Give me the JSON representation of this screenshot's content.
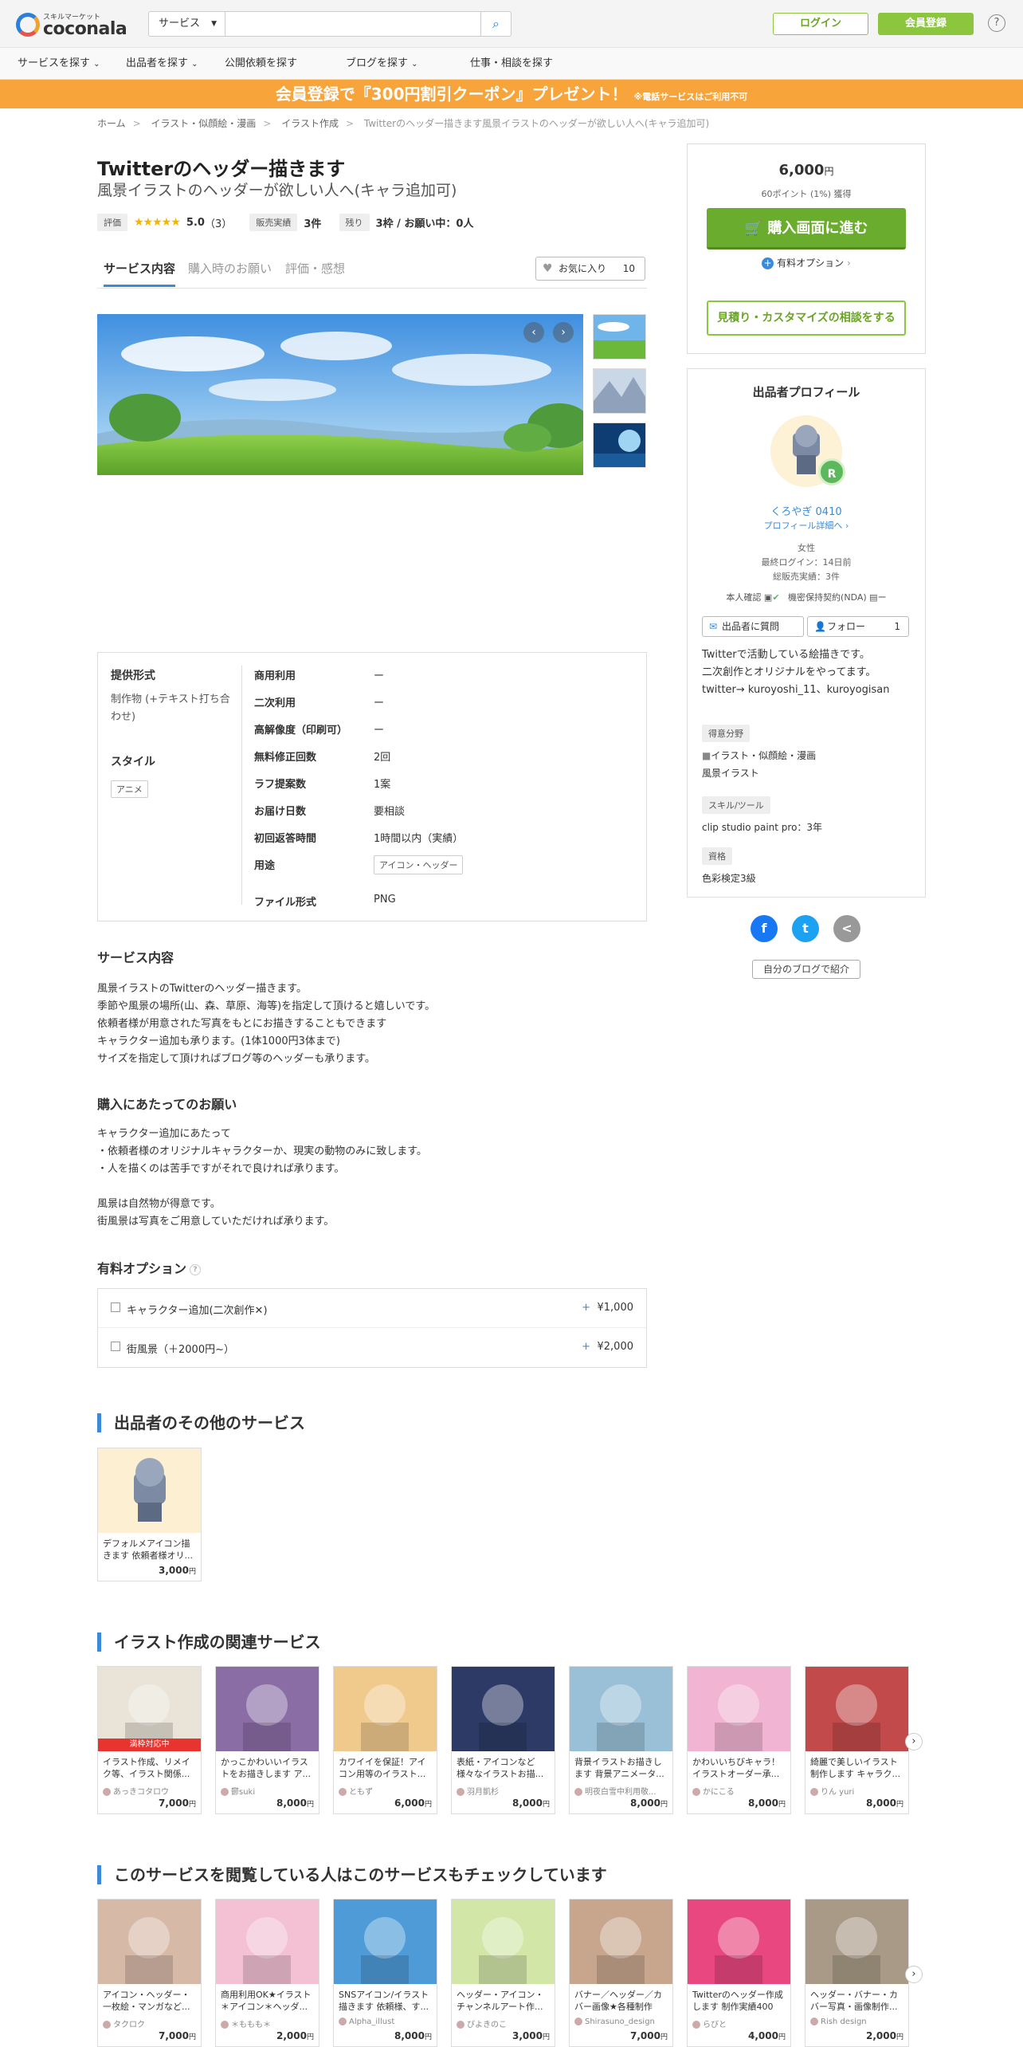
{
  "header": {
    "logo_sub": "スキルマーケット",
    "logo_word": "coconala",
    "search_category": "サービス",
    "search_placeholder": "",
    "login_label": "ログイン",
    "register_label": "会員登録",
    "help_label": "?"
  },
  "nav": [
    "サービスを探す",
    "出品者を探す",
    "公開依頼を探す",
    "ブログを探す",
    "仕事・相談を探す"
  ],
  "banner": {
    "main": "会員登録で『300円割引クーポン』プレゼント！",
    "note": "※電話サービスはご利用不可"
  },
  "breadcrumb": [
    "ホーム",
    "イラスト・似顔絵・漫画",
    "イラスト作成",
    "Twitterのヘッダー描きます風景イラストのヘッダーが欲しい人へ(キャラ追加可)"
  ],
  "service": {
    "title": "Twitterのヘッダー描きます",
    "subtitle": "風景イラストのヘッダーが欲しい人へ(キャラ追加可)",
    "rating_label": "評価",
    "rating": "5.0",
    "rating_count": "（3）",
    "sales_label": "販売実績",
    "sales_value": "3件",
    "remain_label": "残り",
    "remain_value": "3枠 / お願い中：0人"
  },
  "tabs": [
    "サービス内容",
    "購入時のお願い",
    "評価・感想"
  ],
  "favorite": {
    "label": "お気に入り",
    "count": "10"
  },
  "spec": {
    "format_h": "提供形式",
    "format_v": "制作物 (+テキスト打ち合わせ)",
    "style_h": "スタイル",
    "style_tag": "アニメ",
    "rows": [
      {
        "k": "商用利用",
        "v": "ー"
      },
      {
        "k": "二次利用",
        "v": "ー"
      },
      {
        "k": "高解像度（印刷可）",
        "v": "ー"
      },
      {
        "k": "無料修正回数",
        "v": "2回"
      },
      {
        "k": "ラフ提案数",
        "v": "1案"
      },
      {
        "k": "お届け日数",
        "v": "要相談"
      },
      {
        "k": "初回返答時間",
        "v": "1時間以内（実績）"
      },
      {
        "k": "用途",
        "v": "アイコン・ヘッダー"
      },
      {
        "k": "ファイル形式",
        "v": "PNG"
      }
    ]
  },
  "content": {
    "h": "サービス内容",
    "lines": [
      "風景イラストのTwitterのヘッダー描きます。",
      "季節や風景の場所(山、森、草原、海等)を指定して頂けると嬉しいです。",
      "依頼者様が用意された写真をもとにお描きすることもできます",
      "キャラクター追加も承ります。(1体1000円3体まで)",
      "サイズを指定して頂ければブログ等のヘッダーも承ります。"
    ]
  },
  "request": {
    "h": "購入にあたってのお願い",
    "lines": [
      "キャラクター追加にあたって",
      "・依頼者様のオリジナルキャラクターか、現実の動物のみに致します。",
      "・人を描くのは苦手ですがそれで良ければ承ります。",
      "",
      "風景は自然物が得意です。",
      "街風景は写真をご用意していただければ承ります。"
    ]
  },
  "paid_options": {
    "h": "有料オプション",
    "items": [
      {
        "label": "キャラクター追加(二次創作✕)",
        "plus": "+",
        "price": "¥1,000"
      },
      {
        "label": "街風景（＋2000円~）",
        "plus": "+",
        "price": "¥2,000"
      }
    ]
  },
  "other_services": {
    "h": "出品者のその他のサービス",
    "items": [
      {
        "text": "デフォルメアイコン描きます 依頼者様オリ...",
        "price": "3,000",
        "unit": "円"
      }
    ]
  },
  "related": {
    "h": "イラスト作成の関連サービス",
    "items": [
      {
        "text": "イラスト作成、リメイク等、イラスト関係...",
        "user": "あっきコタロウ",
        "price": "7,000",
        "unit": "円",
        "badge": "満枠対応中",
        "color": "#e9e3d8"
      },
      {
        "text": "かっこかわいいイラストをお描きします ア...",
        "user": "鬱suki",
        "price": "8,000",
        "unit": "円",
        "color": "#8b6da6"
      },
      {
        "text": "カワイイを保証！アイコン用等のイラスト...",
        "user": "ともず",
        "price": "6,000",
        "unit": "円",
        "color": "#f0c98d"
      },
      {
        "text": "表紙・アイコンなど様々なイラストお描...",
        "user": "羽月凱杉",
        "price": "8,000",
        "unit": "円",
        "color": "#2d3a66"
      },
      {
        "text": "背景イラストお描きします 背景アニメータ...",
        "user": "明夜白雪中利用敬...",
        "price": "8,000",
        "unit": "円",
        "color": "#9ac0d8"
      },
      {
        "text": "かわいいちびキャラ！イラストオーダー承...",
        "user": "かにこる",
        "price": "8,000",
        "unit": "円",
        "color": "#f1b4d2"
      },
      {
        "text": "綺麗で美しいイラスト制作します キャラク...",
        "user": "りん yuri",
        "price": "8,000",
        "unit": "円",
        "color": "#c24a4a"
      }
    ]
  },
  "viewed": {
    "h": "このサービスを閲覧している人はこのサービスもチェックしています",
    "items": [
      {
        "text": "アイコン・ヘッダー・一枚絵・マンガなど...",
        "user": "タクロク",
        "price": "7,000",
        "unit": "円",
        "color": "#d7b9a8"
      },
      {
        "text": "商用利用OK★イラスト＊アイコン＊ヘッダ...",
        "user": "＊ももも＊",
        "price": "2,000",
        "unit": "円",
        "color": "#f3c0d4"
      },
      {
        "text": "SNSアイコン/イラスト描きます 依頼様、す...",
        "user": "Alpha_illust",
        "price": "8,000",
        "unit": "円",
        "color": "#4e9bd8"
      },
      {
        "text": "ヘッダー・アイコン・チャンネルアート作...",
        "user": "ぴよきのこ",
        "price": "3,000",
        "unit": "円",
        "color": "#d2e6a8"
      },
      {
        "text": "バナー／ヘッダー／カバー画像★各種制作致...",
        "user": "Shirasuno_design",
        "price": "7,000",
        "unit": "円",
        "color": "#c8a68e"
      },
      {
        "text": "Twitterのヘッダー作成します 制作実績400件...",
        "user": "らびと",
        "price": "4,000",
        "unit": "円",
        "color": "#e8477f"
      },
      {
        "text": "ヘッダー・バナー・カバー写真・画像制作...",
        "user": "Rish design",
        "price": "2,000",
        "unit": "円",
        "color": "#a89a86"
      }
    ]
  },
  "purchase": {
    "price": "6,000",
    "unit": "円",
    "points": "60ポイント (1%) 獲得",
    "buy_label": "購入画面に進む",
    "option_label": "有料オプション",
    "consult_label": "見積り・カスタマイズの相談をする"
  },
  "profile": {
    "h": "出品者プロフィール",
    "rank": "R",
    "name": "くろやぎ 0410",
    "detail_link": "プロフィール詳細へ",
    "gender": "女性",
    "last_login": "最終ログイン：14日前",
    "total_sales": "総販売実績：3件",
    "verify": "本人確認",
    "nda": "機密保持契約(NDA)",
    "nda_value": "ー",
    "ask_label": "出品者に質問",
    "follow_label": "フォロー",
    "follow_count": "1",
    "bio": [
      "Twitterで活動している絵描きです。",
      "二次創作とオリジナルをやってます。",
      "twitter→ kuroyoshi_11、kuroyogisan"
    ],
    "field_h": "得意分野",
    "field_1": "イラスト・似顔絵・漫画",
    "field_2": "風景イラスト",
    "tool_h": "スキル/ツール",
    "tool_v": "clip studio paint pro：3年",
    "qual_h": "資格",
    "qual_v": "色彩検定3級"
  },
  "share": {
    "fb": "f",
    "tw": "t",
    "other": "<",
    "blog_label": "自分のブログで紹介"
  },
  "colors": {
    "accent": "#3b8ad9",
    "green": "#8cc63f",
    "banner": "#f7a43b"
  }
}
